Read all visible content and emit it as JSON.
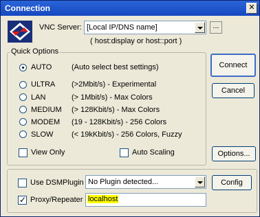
{
  "window": {
    "title": "Connection",
    "close_glyph": "✕"
  },
  "server": {
    "label": "VNC Server:",
    "value": "[Local IP/DNS name]",
    "hint": "( host:display or host::port )",
    "browse_label": "..."
  },
  "quick_options": {
    "title": "Quick Options",
    "options": [
      {
        "name": "AUTO",
        "desc": "(Auto select best settings)",
        "selected": true
      },
      {
        "name": "ULTRA",
        "desc": "(>2Mbit/s) - Experimental",
        "selected": false
      },
      {
        "name": "LAN",
        "desc": "(> 1Mbit/s) - Max Colors",
        "selected": false
      },
      {
        "name": "MEDIUM",
        "desc": "(> 128Kbit/s) - Max Colors",
        "selected": false
      },
      {
        "name": "MODEM",
        "desc": "(19 - 128Kbit/s) - 256 Colors",
        "selected": false
      },
      {
        "name": "SLOW",
        "desc": "(< 19kKbit/s) - 256 Colors, Fuzzy",
        "selected": false
      }
    ],
    "view_only": {
      "label": "View Only",
      "checked": false
    },
    "auto_scaling": {
      "label": "Auto Scaling",
      "checked": false
    }
  },
  "buttons": {
    "connect": "Connect",
    "cancel": "Cancel",
    "options": "Options...",
    "config": "Config"
  },
  "plugin": {
    "use_dsm_label": "Use DSMPlugin",
    "use_dsm_checked": false,
    "plugin_value": "No Plugin detected...",
    "proxy_label": "Proxy/Repeater",
    "proxy_checked": true,
    "proxy_value": "localhost"
  },
  "icons": {
    "logo": "vnc-logo-icon"
  }
}
